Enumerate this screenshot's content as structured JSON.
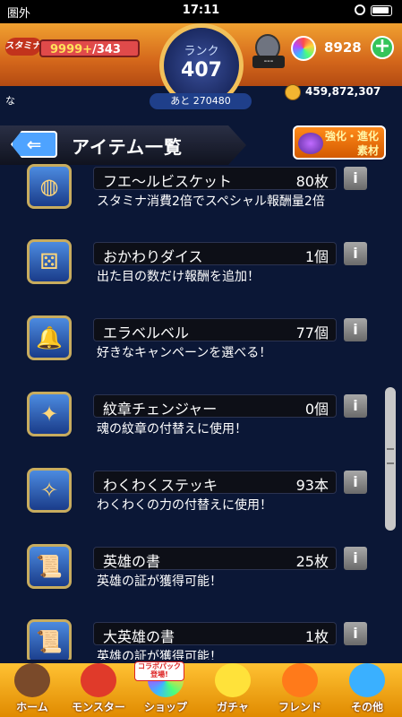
{
  "status_bar": {
    "carrier": "圏外",
    "time": "17:11"
  },
  "header": {
    "stamina_label": "スタミナ",
    "stamina_value": "9999+",
    "stamina_max": "/343",
    "rank_label": "ランク",
    "rank_value": "407",
    "next_rank": "あと 270480",
    "gacha_label": "---",
    "orb_count": "8928",
    "plus_label": "+",
    "coin_count": "459,872,307",
    "left_text": "な"
  },
  "title_bar": {
    "back_label": "⇐",
    "title": "アイテム一覧",
    "evolve_label_1": "強化・進化",
    "evolve_label_2": "素材"
  },
  "items": [
    {
      "name": "フエ〜ルビスケット",
      "count": "80枚",
      "desc": "スタミナ消費2倍でスペシャル報酬量2倍",
      "icon": "biscuit-icon",
      "glyph": "◍"
    },
    {
      "name": "おかわりダイス",
      "count": "1個",
      "desc": "出た目の数だけ報酬を追加！",
      "icon": "dice-icon",
      "glyph": "⚄"
    },
    {
      "name": "エラベルベル",
      "count": "77個",
      "desc": "好きなキャンペーンを選べる！",
      "icon": "bell-icon",
      "glyph": "🔔"
    },
    {
      "name": "紋章チェンジャー",
      "count": "0個",
      "desc": "魂の紋章の付替えに使用！",
      "icon": "emblem-icon",
      "glyph": "✦"
    },
    {
      "name": "わくわくステッキ",
      "count": "93本",
      "desc": "わくわくの力の付替えに使用！",
      "icon": "stick-icon",
      "glyph": "✧"
    },
    {
      "name": "英雄の書",
      "count": "25枚",
      "desc": "英雄の証が獲得可能！",
      "icon": "scroll-icon",
      "glyph": "📜"
    },
    {
      "name": "大英雄の書",
      "count": "1枚",
      "desc": "英雄の証が獲得可能！",
      "icon": "big-scroll-icon",
      "glyph": "📜"
    }
  ],
  "info_label": "i",
  "bottom_nav": {
    "items": [
      "ホーム",
      "モンスター",
      "ショップ",
      "ガチャ",
      "フレンド",
      "その他"
    ],
    "collab_tag": "コラボパック登場!"
  }
}
